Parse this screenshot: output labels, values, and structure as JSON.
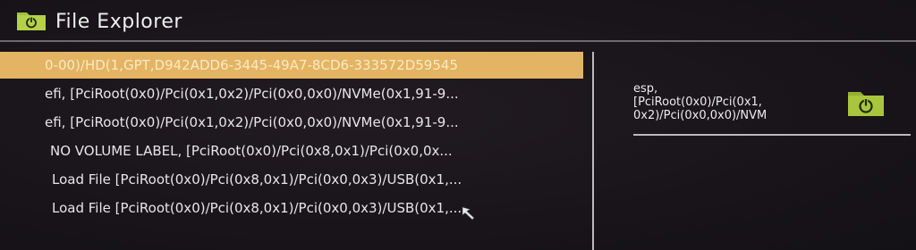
{
  "window": {
    "title": "File Explorer",
    "icon": "folder-power-icon"
  },
  "colors": {
    "background": "#191519",
    "selection": "#e3b463",
    "icon_green": "#a2c13a",
    "text": "#e9e6ea"
  },
  "file_list": [
    {
      "label": "0-00)/HD(1,GPT,D942ADD6-3445-49A7-8CD6-333572D59545",
      "selected": true
    },
    {
      "label": "efi, [PciRoot(0x0)/Pci(0x1,0x2)/Pci(0x0,0x0)/NVMe(0x1,91-9...",
      "selected": false
    },
    {
      "label": "efi, [PciRoot(0x0)/Pci(0x1,0x2)/Pci(0x0,0x0)/NVMe(0x1,91-9...",
      "selected": false
    },
    {
      "label": "NO VOLUME LABEL, [PciRoot(0x0)/Pci(0x8,0x1)/Pci(0x0,0x...",
      "selected": false
    },
    {
      "label": "Load File [PciRoot(0x0)/Pci(0x8,0x1)/Pci(0x0,0x3)/USB(0x1,...",
      "selected": false
    },
    {
      "label": "Load File [PciRoot(0x0)/Pci(0x8,0x1)/Pci(0x0,0x3)/USB(0x1,...",
      "selected": false
    }
  ],
  "detail": {
    "text": "esp,\n[PciRoot(0x0)/Pci(0x1,\n0x2)/Pci(0x0,0x0)/NVM",
    "icon": "folder-power-icon"
  },
  "cursor": {
    "icon": "mouse-pointer-icon"
  }
}
